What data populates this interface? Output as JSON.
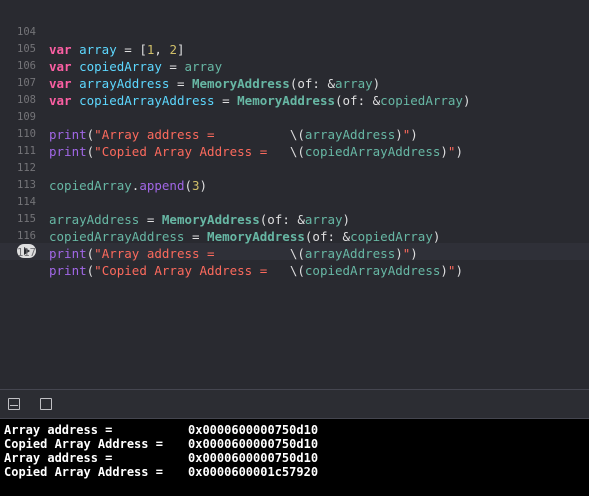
{
  "editor": {
    "lines": [
      {
        "num": "104"
      },
      {
        "num": "105"
      },
      {
        "num": "106"
      },
      {
        "num": "107"
      },
      {
        "num": "108"
      },
      {
        "num": "109"
      },
      {
        "num": "110"
      },
      {
        "num": "111"
      },
      {
        "num": "112"
      },
      {
        "num": "113"
      },
      {
        "num": "114"
      },
      {
        "num": "115"
      },
      {
        "num": "116"
      },
      {
        "num": "117"
      }
    ],
    "tokens": {
      "kw_var": "var",
      "array": "array",
      "copiedArray": "copiedArray",
      "arrayAddress": "arrayAddress",
      "copiedArrayAddress": "copiedArrayAddress",
      "MemoryAddress": "MemoryAddress",
      "print": "print",
      "append": "append",
      "of": "of:",
      "one": "1",
      "two": "2",
      "three": "3",
      "str_array_address": "\"Array address =          ",
      "str_copied_address": "\"Copied Array Address =   ",
      "quote": "\"",
      "interp_open": "\\(",
      "interp_close": ")"
    }
  },
  "debug_toolbar": {
    "hide_icon": "panel-hide-icon",
    "split_icon": "panel-split-icon"
  },
  "console": {
    "lines": [
      {
        "label": "Array address =",
        "value": "0x0000600000750d10"
      },
      {
        "label": "Copied Array Address =",
        "value": "0x0000600000750d10"
      },
      {
        "label": "Array address =",
        "value": "0x0000600000750d10"
      },
      {
        "label": "Copied Array Address =",
        "value": "0x0000600001c57920"
      }
    ]
  },
  "colors": {
    "editor_bg": "#292a30",
    "keyword": "#fc5fa3",
    "variable": "#5dd8ff",
    "function": "#67b7a4",
    "string": "#fc6a5d",
    "number": "#d0bf69",
    "console_bg": "#000000"
  }
}
